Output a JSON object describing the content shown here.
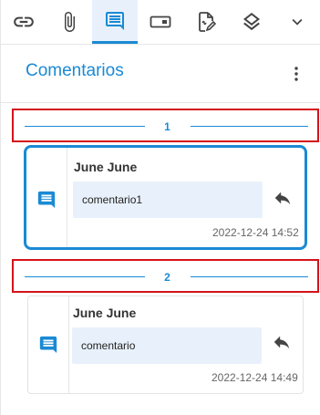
{
  "toolbar": {
    "tools": [
      {
        "icon": "link-icon"
      },
      {
        "icon": "paperclip-icon"
      },
      {
        "icon": "comment-icon",
        "active": true
      },
      {
        "icon": "form-field-icon"
      },
      {
        "icon": "signature-document-icon"
      },
      {
        "icon": "layers-icon"
      },
      {
        "icon": "chevron-down-icon"
      }
    ]
  },
  "header": {
    "title": "Comentarios"
  },
  "groups": [
    {
      "label": "1",
      "comments": [
        {
          "author": "June June",
          "text": "comentario1",
          "timestamp": "2022-12-24 14:52",
          "selected": true
        }
      ]
    },
    {
      "label": "2",
      "comments": [
        {
          "author": "June June",
          "text": "comentario",
          "timestamp": "2022-12-24 14:49",
          "selected": false
        }
      ]
    }
  ],
  "colors": {
    "accent": "#1a8ad4",
    "highlight_border": "#d5121a",
    "bubble_bg": "#e8f1fb",
    "icon_gray": "#444444"
  }
}
